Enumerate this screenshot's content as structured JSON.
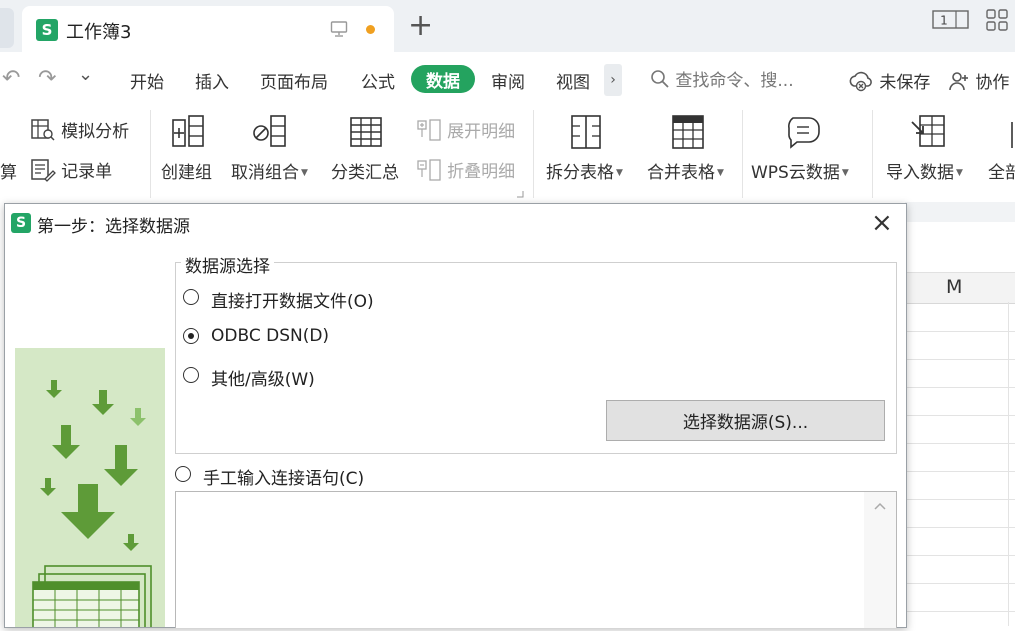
{
  "titlebar": {
    "app_logo": "S",
    "doc_title": "工作簿3",
    "new_tab": "+",
    "page_view_icon_text": "1"
  },
  "tabs": {
    "quick_access": [
      "↶",
      "↷",
      "⌄"
    ],
    "items": [
      "开始",
      "插入",
      "页面布局",
      "公式",
      "数据",
      "审阅",
      "视图"
    ],
    "active": "数据",
    "more": "›",
    "search_placeholder": "查找命令、搜..."
  },
  "status": {
    "save_status": "未保存",
    "collab": "协作"
  },
  "ribbon": {
    "left_partial": "算",
    "simulate": "模拟分析",
    "record_form": "记录单",
    "create_group": "创建组",
    "ungroup": "取消组合",
    "subtotal": "分类汇总",
    "expand_detail": "展开明细",
    "collapse_detail": "折叠明细",
    "split_table": "拆分表格",
    "merge_table": "合并表格",
    "wps_cloud": "WPS云数据",
    "import_data": "导入数据",
    "right_partial": "全部"
  },
  "sheet": {
    "column_header": "M"
  },
  "dialog": {
    "logo": "S",
    "title": "第一步：选择数据源",
    "close": "×",
    "group_title": "数据源选择",
    "options": [
      {
        "label": "直接打开数据文件(O)",
        "checked": false
      },
      {
        "label": "ODBC DSN(D)",
        "checked": true
      },
      {
        "label": "其他/高级(W)",
        "checked": false
      }
    ],
    "select_button": "选择数据源(S)...",
    "manual_option": "手工输入连接语句(C)"
  },
  "colors": {
    "accent": "#24a35f",
    "wps_green": "#23a566",
    "unsaved_dot": "#f0a020",
    "illustration_bg": "#d5e8c6",
    "arrow_dark": "#4f8f2b",
    "arrow_light": "#8cc16b"
  }
}
